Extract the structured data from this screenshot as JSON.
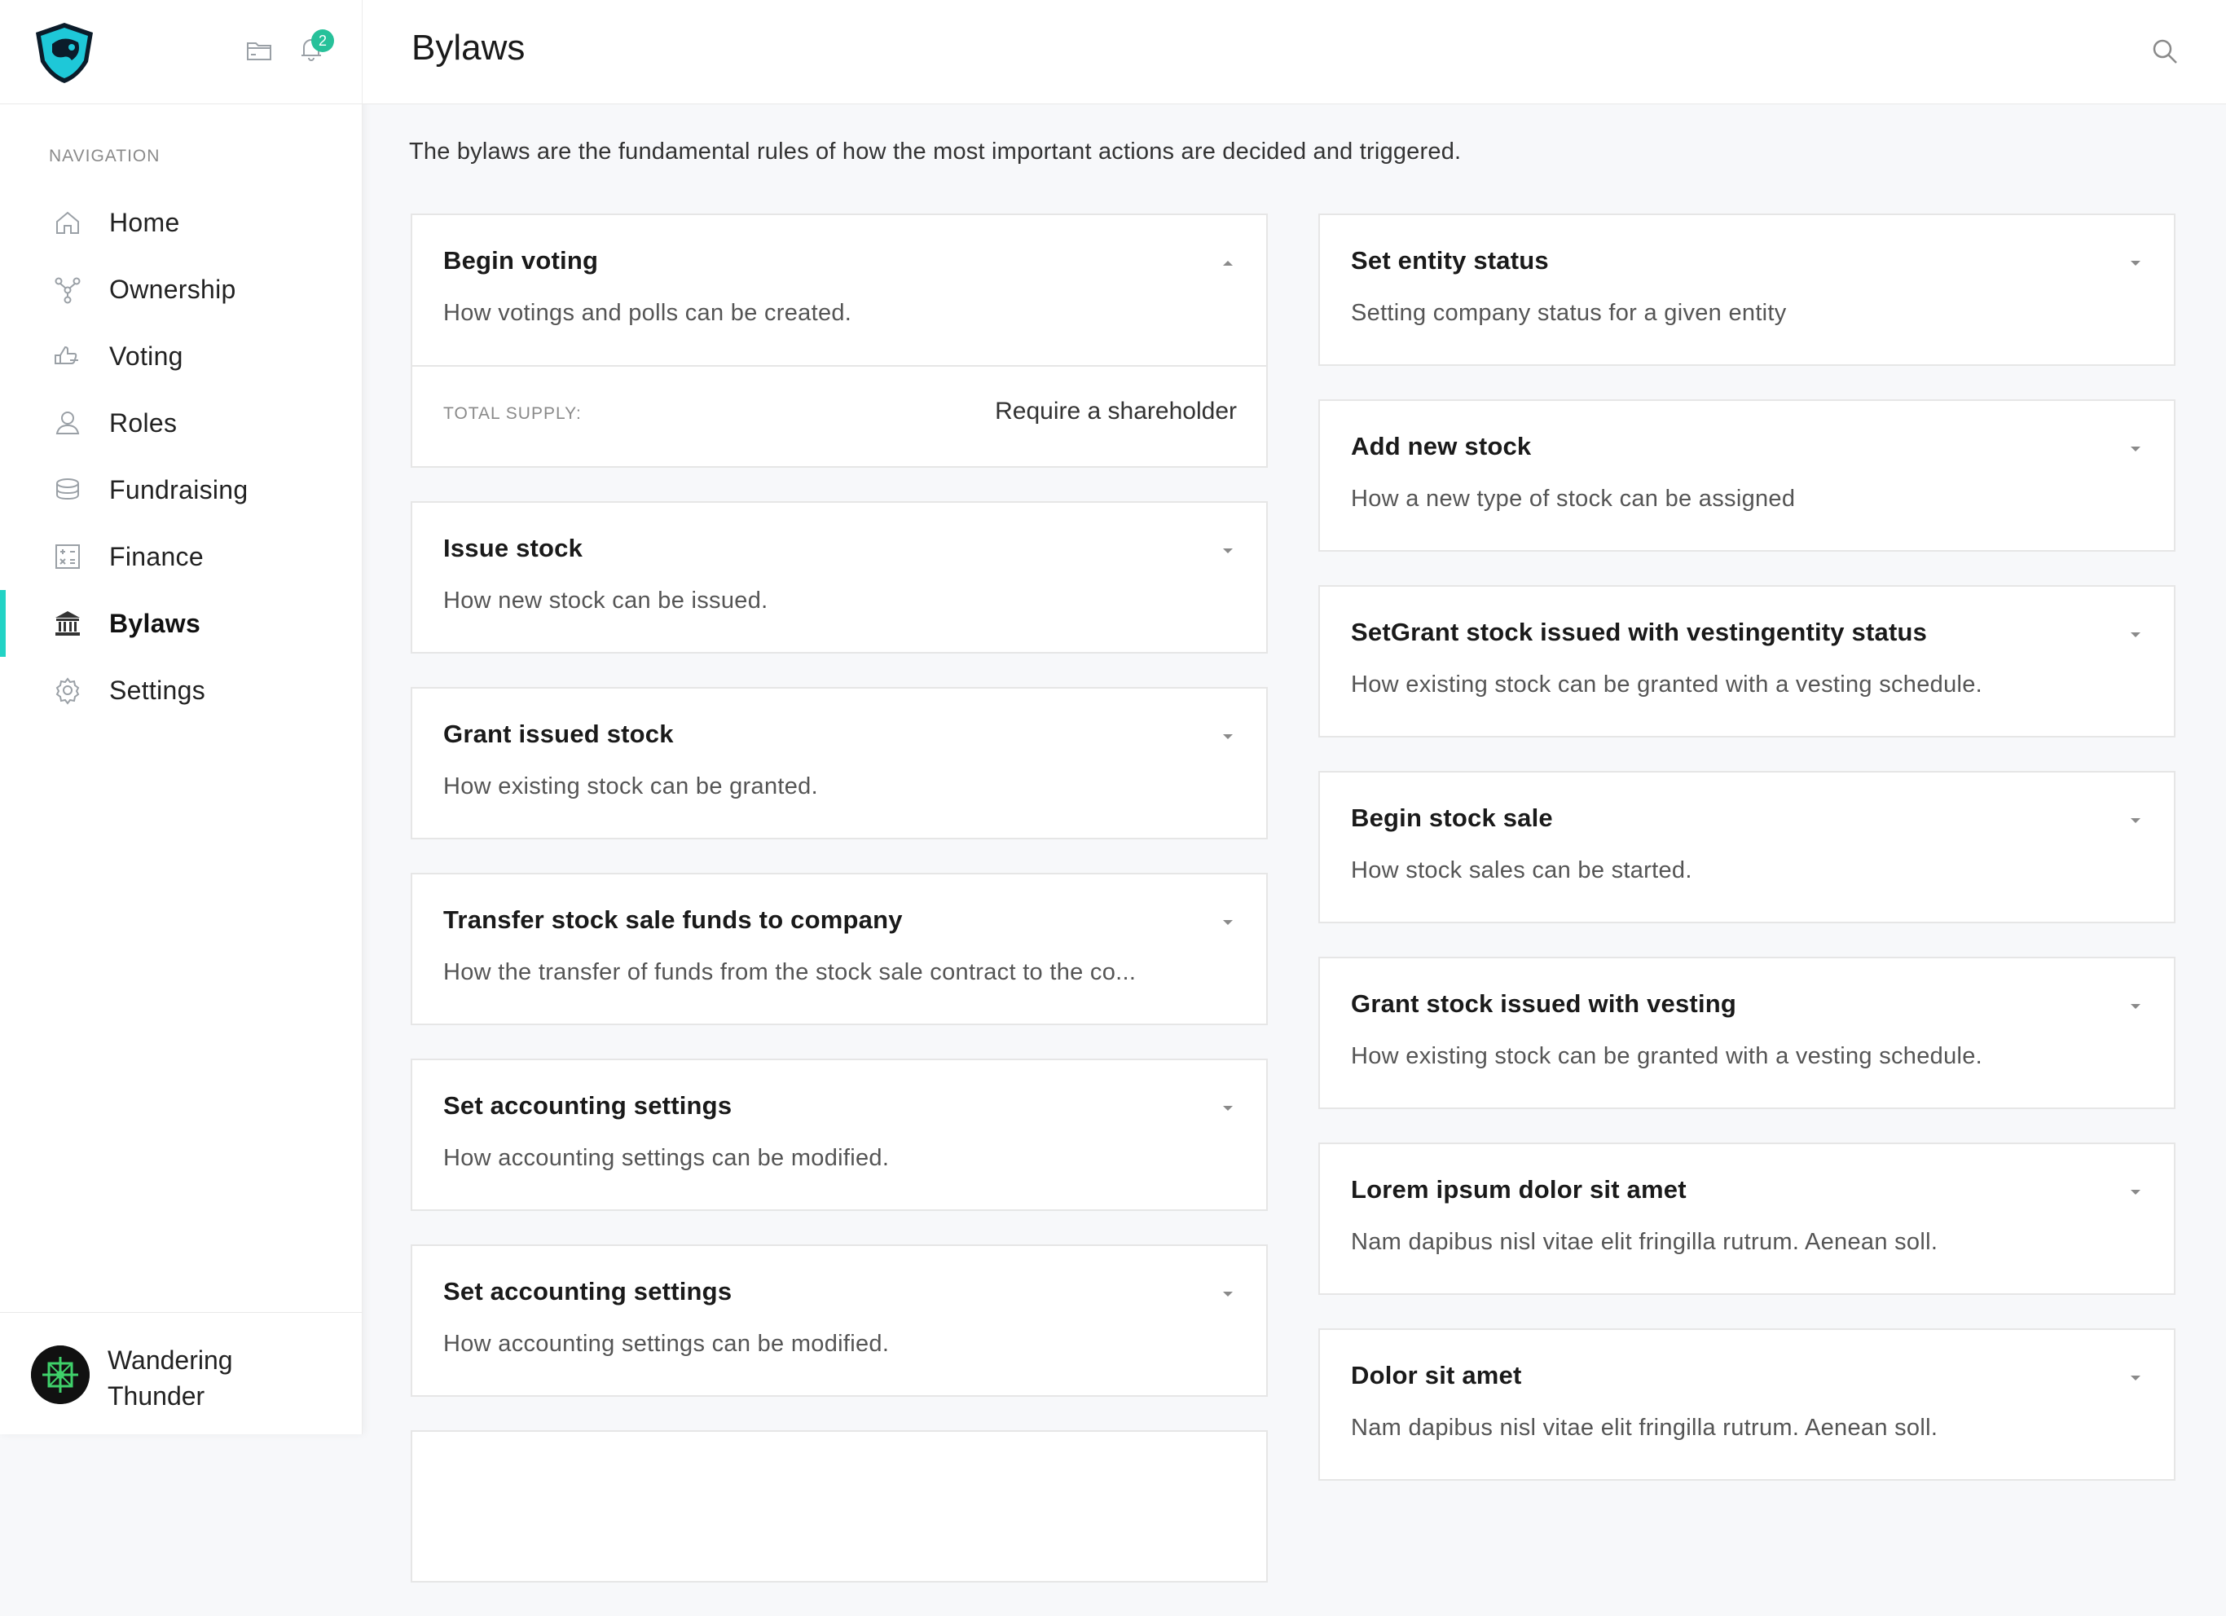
{
  "app": {
    "notifications_count": "2",
    "accent_color": "#22d3c5",
    "badge_color": "#27c19a"
  },
  "sidebar": {
    "heading": "NAVIGATION",
    "items": [
      {
        "label": "Home",
        "icon": "home-icon",
        "active": false
      },
      {
        "label": "Ownership",
        "icon": "ownership-icon",
        "active": false
      },
      {
        "label": "Voting",
        "icon": "voting-icon",
        "active": false
      },
      {
        "label": "Roles",
        "icon": "roles-icon",
        "active": false
      },
      {
        "label": "Fundraising",
        "icon": "fundraising-icon",
        "active": false
      },
      {
        "label": "Finance",
        "icon": "finance-icon",
        "active": false
      },
      {
        "label": "Bylaws",
        "icon": "bylaws-icon",
        "active": true
      },
      {
        "label": "Settings",
        "icon": "gear-icon",
        "active": false
      }
    ],
    "user": {
      "name": "Wandering Thunder"
    }
  },
  "header": {
    "title": "Bylaws"
  },
  "main": {
    "intro": "The bylaws are the fundamental rules of how the most important actions are decided and triggered.",
    "left_cards": [
      {
        "title": "Begin voting",
        "description": "How votings and polls can be created.",
        "expanded": true,
        "meta_label": "TOTAL SUPPLY:",
        "meta_value": "Require a shareholder"
      },
      {
        "title": "Issue stock",
        "description": "How new stock can be issued."
      },
      {
        "title": "Grant issued stock",
        "description": "How existing stock can be granted."
      },
      {
        "title": "Transfer stock sale funds to company",
        "description": "How the transfer of funds from the stock sale contract to the co..."
      },
      {
        "title": "Set accounting settings",
        "description": "How accounting settings can be modified."
      },
      {
        "title": "Set accounting settings",
        "description": "How accounting settings can be modified."
      }
    ],
    "right_cards": [
      {
        "title": "Set entity status",
        "description": "Setting company status for a given entity"
      },
      {
        "title": "Add new stock",
        "description": "How a new type of stock can be assigned"
      },
      {
        "title": "SetGrant stock issued with vestingentity status",
        "description": "How existing stock can be granted with a vesting schedule."
      },
      {
        "title": "Begin stock sale",
        "description": "How stock sales can be started."
      },
      {
        "title": "Grant stock issued with vesting",
        "description": "How existing stock can be granted with a vesting schedule."
      },
      {
        "title": "Lorem ipsum dolor sit amet",
        "description": "Nam dapibus nisl vitae elit fringilla rutrum. Aenean soll."
      },
      {
        "title": "Dolor sit amet",
        "description": "Nam dapibus nisl vitae elit fringilla rutrum. Aenean soll."
      }
    ]
  }
}
